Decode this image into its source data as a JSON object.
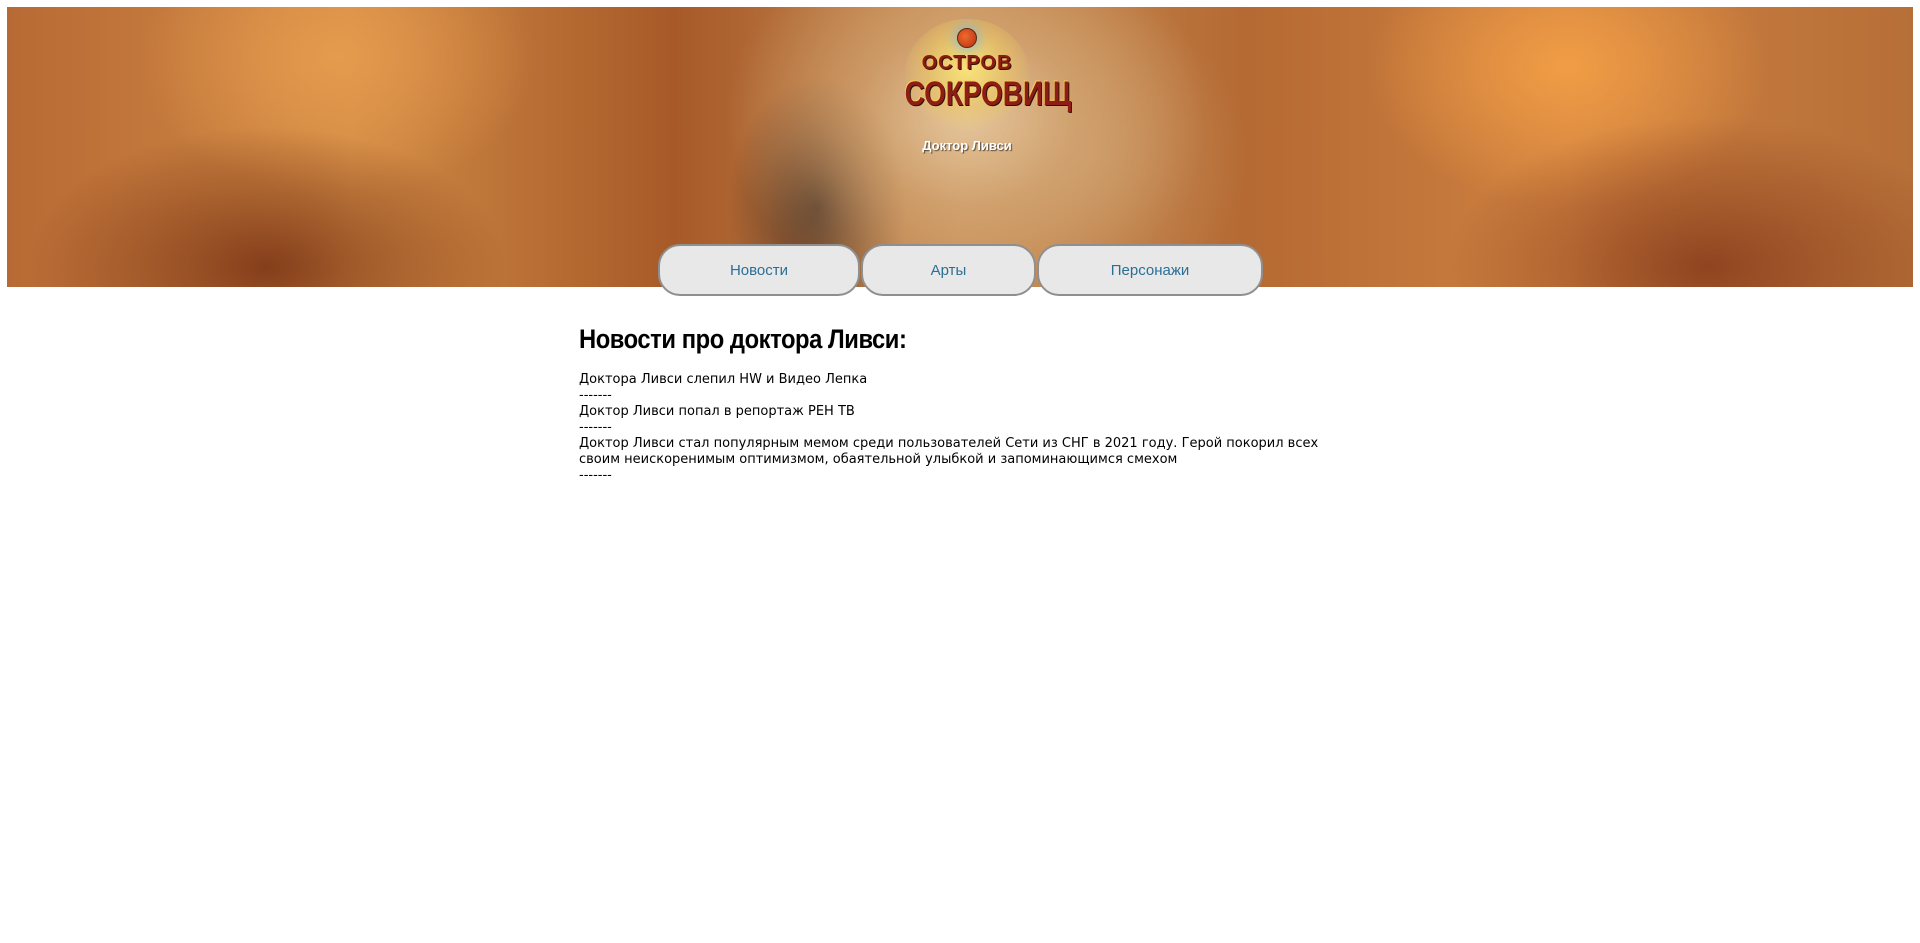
{
  "header": {
    "logo": {
      "line1": "ОСТРОВ",
      "line2": "СОКРОВИЩ"
    },
    "subtitle": "Доктор Ливси"
  },
  "nav": {
    "items": [
      {
        "label": "Новости"
      },
      {
        "label": "Арты"
      },
      {
        "label": "Персонажи"
      }
    ]
  },
  "main": {
    "title": "Новости про доктора Ливси:",
    "news": [
      {
        "text": "Доктора Ливси слепил HW и Видео Лепка",
        "separator": "-------"
      },
      {
        "text": "Доктор Ливси попал в репортаж РЕН ТВ",
        "separator": "-------"
      },
      {
        "text": "Доктор Ливси стал популярным мемом среди пользователей Сети из СНГ в 2021 году. Герой покорил всех своим неискоренимым оптимизмом, обаятельной улыбкой и запоминающимся смехом",
        "separator": "-------"
      }
    ]
  },
  "colors": {
    "nav_text": "#2a6f95",
    "nav_bg": "#e8e8e8",
    "nav_border": "#8f8f8f"
  }
}
